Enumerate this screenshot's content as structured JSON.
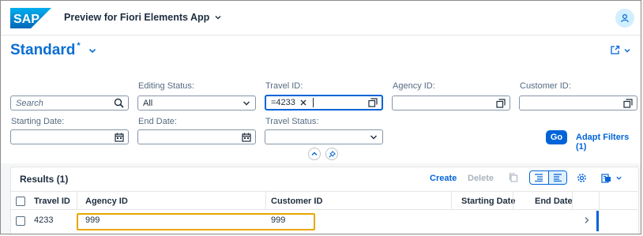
{
  "shell": {
    "logo_text": "SAP",
    "app_title": "Preview for Fiori Elements App"
  },
  "header": {
    "variant_name": "Standard",
    "variant_modified": "*"
  },
  "filters": {
    "search_placeholder": "Search",
    "editing_status_label": "Editing Status:",
    "editing_status_value": "All",
    "travel_id_label": "Travel ID:",
    "travel_id_token": "=4233",
    "agency_id_label": "Agency ID:",
    "customer_id_label": "Customer ID:",
    "starting_date_label": "Starting Date:",
    "end_date_label": "End Date:",
    "travel_status_label": "Travel Status:",
    "go_label": "Go",
    "adapt_filters_label": "Adapt Filters (1)"
  },
  "table": {
    "title": "Results (1)",
    "create_label": "Create",
    "delete_label": "Delete",
    "columns": [
      "Travel ID",
      "Agency ID",
      "Customer ID",
      "Starting Date",
      "End Date"
    ],
    "rows": [
      {
        "travel_id": "4233",
        "agency_id": "999",
        "customer_id": "999",
        "starting_date": "",
        "end_date": ""
      }
    ]
  },
  "colors": {
    "accent": "#0064d9",
    "highlight": "#e9a700",
    "title_blue": "#0a6ed1"
  }
}
